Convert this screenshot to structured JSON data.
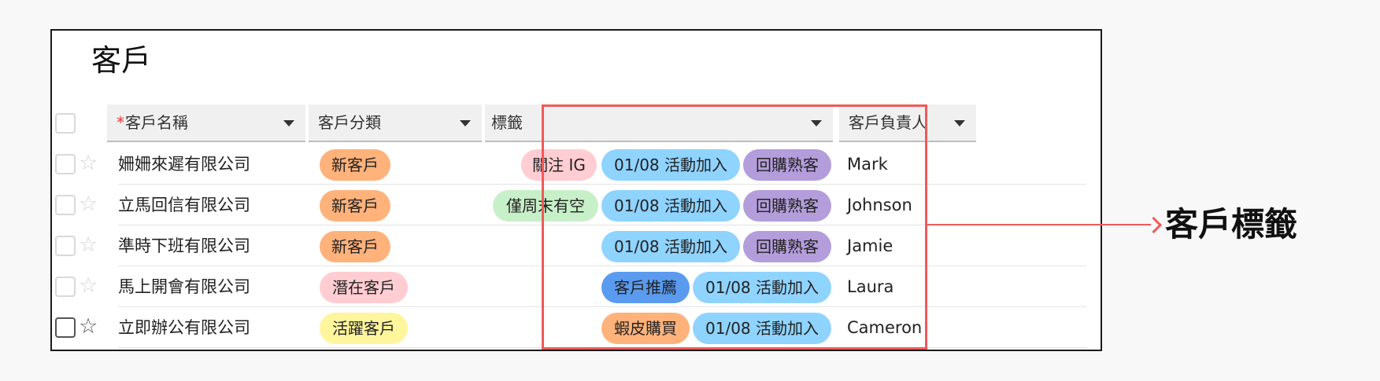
{
  "page_title": "客戶",
  "columns": {
    "name": {
      "required_mark": "*",
      "label": "客戶名稱"
    },
    "category": {
      "label": "客戶分類"
    },
    "tags": {
      "label": "標籤"
    },
    "owner": {
      "label": "客戶負責人"
    }
  },
  "rows": [
    {
      "name": "姍姍來遲有限公司",
      "category": "新客戶",
      "tags": [
        "關注 IG",
        "01/08 活動加入",
        "回購熟客"
      ],
      "owner": "Mark"
    },
    {
      "name": "立馬回信有限公司",
      "category": "新客戶",
      "tags": [
        "僅周末有空",
        "01/08 活動加入",
        "回購熟客"
      ],
      "owner": "Johnson"
    },
    {
      "name": "準時下班有限公司",
      "category": "新客戶",
      "tags": [
        "01/08 活動加入",
        "回購熟客"
      ],
      "owner": "Jamie"
    },
    {
      "name": "馬上開會有限公司",
      "category": "潛在客戶",
      "tags": [
        "客戶推薦",
        "01/08 活動加入"
      ],
      "owner": "Laura"
    },
    {
      "name": "立即辦公有限公司",
      "category": "活躍客戶",
      "tags": [
        "蝦皮購買",
        "01/08 活動加入"
      ],
      "owner": "Cameron"
    }
  ],
  "callout_label": "客戶標籤",
  "colors": {
    "category_new": "#ffb27a",
    "category_potential": "#ffcdd2",
    "category_active": "#fff59d",
    "tag_ig": "#ffcdd2",
    "tag_event": "#8fd3ff",
    "tag_repeat": "#b39ddb",
    "tag_weekend": "#c8f0c8",
    "tag_referral": "#5a9bef",
    "tag_shopee": "#ffb27a",
    "highlight": "#ef5a5a"
  }
}
